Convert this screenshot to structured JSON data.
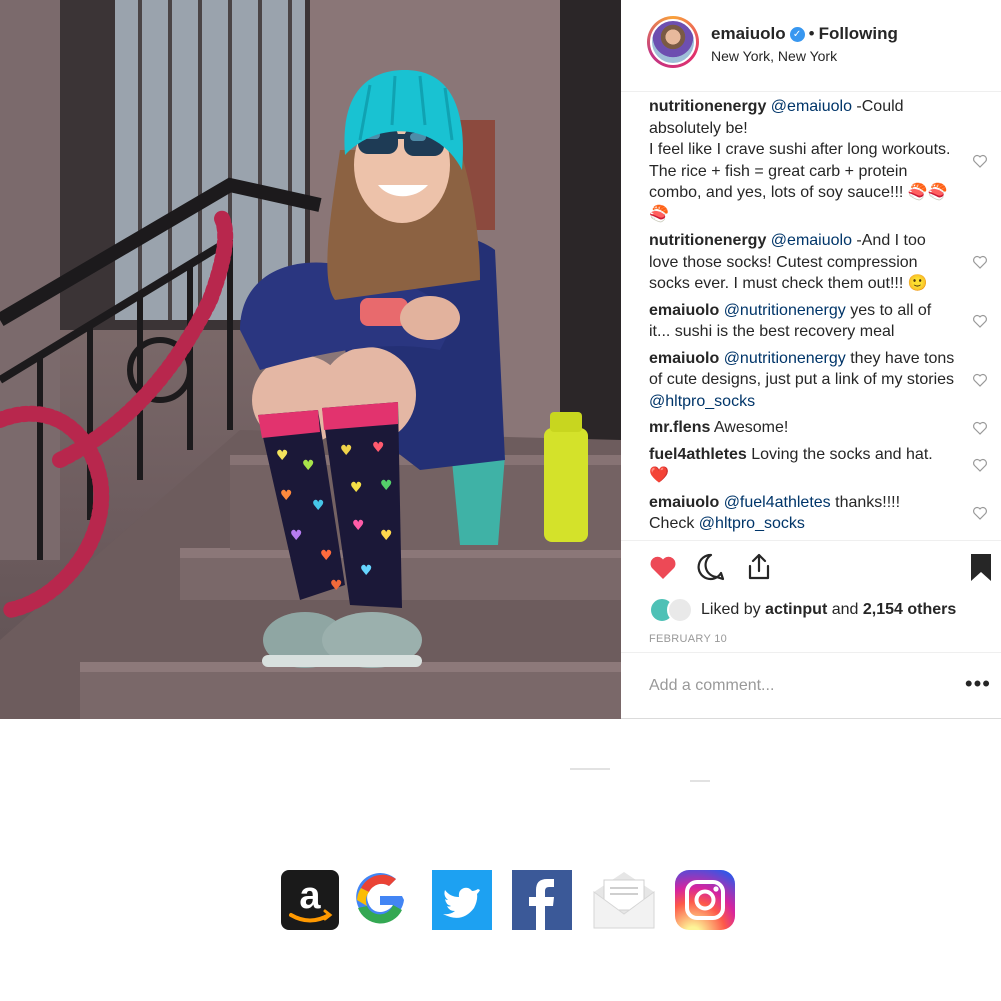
{
  "post": {
    "username": "emaiuolo",
    "verified_icon": "verified-badge-icon",
    "separator": "•",
    "follow_status": "Following",
    "location": "New York, New York",
    "comments": [
      {
        "author": "nutritionenergy",
        "mention": "@emaiuolo",
        "text": " -Could absolutely be!\nI feel like I crave sushi after long workouts. The rice + fish = great carb + protein combo, and yes, lots of soy sauce!!! 🍣🍣🍣"
      },
      {
        "author": "nutritionenergy",
        "mention": "@emaiuolo",
        "text": " -And I too love those socks! Cutest compression socks ever. I must check them out!!! 🙂"
      },
      {
        "author": "emaiuolo",
        "mention": "@nutritionenergy",
        "text": " yes to all of it... sushi is the best recovery meal"
      },
      {
        "author": "emaiuolo",
        "mention": "@nutritionenergy",
        "text": " they have tons of cute designs, just put a link of my stories ",
        "mention2": "@hltpro_socks"
      },
      {
        "author": "mr.flens",
        "mention": "",
        "text": " Awesome!"
      },
      {
        "author": "fuel4athletes",
        "mention": "",
        "text": " Loving the socks and hat. ❤️"
      },
      {
        "author": "emaiuolo",
        "mention": "@fuel4athletes",
        "text": " thanks!!!!\nCheck ",
        "mention2": "@hltpro_socks"
      }
    ],
    "liked_prefix": "Liked by ",
    "liked_user": "actinput",
    "liked_and": " and ",
    "liked_count": "2,154 others",
    "date": "FEBRUARY 10",
    "add_comment_placeholder": "Add a comment...",
    "more_label": "•••"
  },
  "icons": {
    "like": "heart-filled-icon",
    "comment": "comment-bubble-icon",
    "share": "share-upload-icon",
    "save": "bookmark-filled-icon",
    "comment_like": "heart-outline-icon"
  },
  "colors": {
    "like_red": "#ed4956",
    "mention_blue": "#003569",
    "verified_blue": "#3897f0"
  },
  "share_row": {
    "icons": [
      "amazon-icon",
      "google-icon",
      "twitter-icon",
      "facebook-icon",
      "email-icon",
      "instagram-icon"
    ],
    "amazon_letter": "a"
  }
}
